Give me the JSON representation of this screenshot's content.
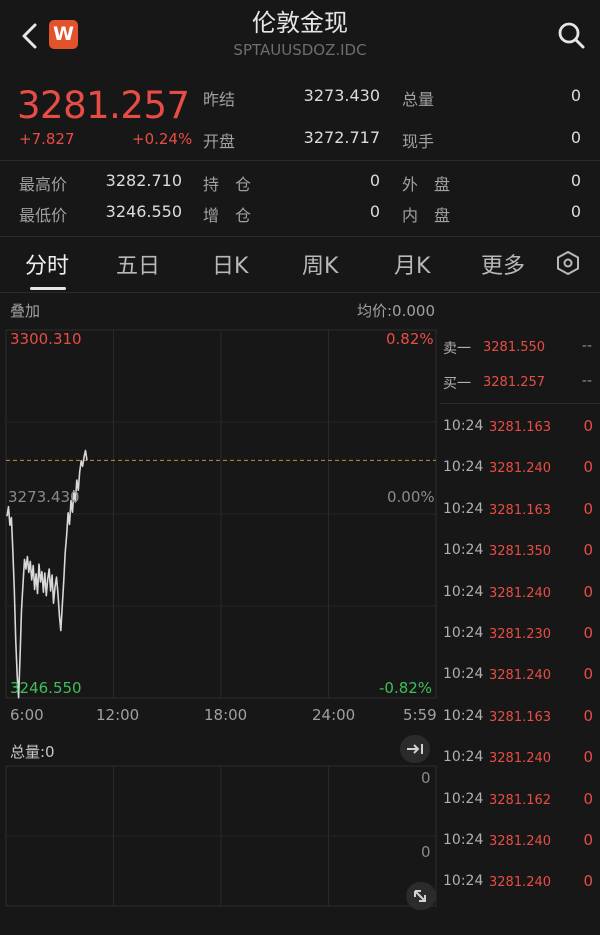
{
  "header": {
    "title": "伦敦金现",
    "code": "SPTAUUSDOZ.IDC",
    "badge": "W"
  },
  "quote": {
    "price": "3281.257",
    "change": "+7.827",
    "change_pct": "+0.24%",
    "stats": [
      {
        "label": "昨结",
        "value": "3273.430"
      },
      {
        "label": "总量",
        "value": "0"
      },
      {
        "label": "开盘",
        "value": "3272.717"
      },
      {
        "label": "现手",
        "value": "0"
      },
      {
        "label": "最高价",
        "value": "3282.710"
      },
      {
        "label": "持　仓",
        "value": "0"
      },
      {
        "label": "外　盘",
        "value": "0"
      },
      {
        "label": "最低价",
        "value": "3246.550"
      },
      {
        "label": "增　仓",
        "value": "0"
      },
      {
        "label": "内　盘",
        "value": "0"
      }
    ]
  },
  "tabs": [
    "分时",
    "五日",
    "日K",
    "周K",
    "月K",
    "更多"
  ],
  "active_tab": "分时",
  "chart": {
    "overlay_label": "叠加",
    "avg_label": "均价:0.000",
    "price_high": "3300.310",
    "price_mid": "3273.430",
    "price_low": "3246.550",
    "pct_high": "0.82%",
    "pct_mid": "0.00%",
    "pct_low": "-0.82%",
    "time_labels": [
      "6:00",
      "12:00",
      "18:00",
      "24:00",
      "5:59"
    ],
    "volume_label": "总量:0",
    "volume_top": "0",
    "volume_mid": "0",
    "colors": {
      "up": "#e84d45",
      "down": "#3fbf5a",
      "line": "#d8d8d8",
      "ref": "#c98a3a"
    }
  },
  "chart_data": {
    "type": "line",
    "x_labels": [
      "6:00",
      "12:00",
      "18:00",
      "24:00",
      "5:59"
    ],
    "ylim": [
      3246.55,
      3300.31
    ],
    "reference": 3273.43,
    "last": 3281.257,
    "series": [
      {
        "values": [
          3273.1,
          3274.5,
          3271.8,
          3272.9,
          3268.2,
          3262.4,
          3255.1,
          3249.8,
          3246.6,
          3252.8,
          3259.4,
          3263.2,
          3266.8,
          3265.4,
          3267.2,
          3264.9,
          3266.5,
          3263.8,
          3265.9,
          3262.4,
          3264.7,
          3261.8,
          3266.1,
          3263.5,
          3265.0,
          3262.0,
          3264.8,
          3261.5,
          3263.9,
          3265.4,
          3262.2,
          3264.5,
          3260.4,
          3262.8,
          3264.2,
          3261.9,
          3258.6,
          3256.4,
          3260.1,
          3263.5,
          3267.8,
          3270.2,
          3273.6,
          3271.9,
          3275.4,
          3273.7,
          3276.8,
          3275.2,
          3278.4,
          3276.9,
          3279.6,
          3281.2,
          3280.4,
          3281.8,
          3282.7,
          3281.257
        ]
      }
    ],
    "volume": {
      "values": [],
      "ylim": [
        0,
        0
      ]
    }
  },
  "order_book": [
    {
      "label": "卖一",
      "price": "3281.550",
      "qty": "--"
    },
    {
      "label": "买一",
      "price": "3281.257",
      "qty": "--"
    }
  ],
  "ticks": [
    {
      "time": "10:24",
      "price": "3281.163",
      "qty": "0"
    },
    {
      "time": "10:24",
      "price": "3281.240",
      "qty": "0"
    },
    {
      "time": "10:24",
      "price": "3281.163",
      "qty": "0"
    },
    {
      "time": "10:24",
      "price": "3281.350",
      "qty": "0"
    },
    {
      "time": "10:24",
      "price": "3281.240",
      "qty": "0"
    },
    {
      "time": "10:24",
      "price": "3281.230",
      "qty": "0"
    },
    {
      "time": "10:24",
      "price": "3281.240",
      "qty": "0"
    },
    {
      "time": "10:24",
      "price": "3281.163",
      "qty": "0"
    },
    {
      "time": "10:24",
      "price": "3281.240",
      "qty": "0"
    },
    {
      "time": "10:24",
      "price": "3281.162",
      "qty": "0"
    },
    {
      "time": "10:24",
      "price": "3281.240",
      "qty": "0"
    },
    {
      "time": "10:24",
      "price": "3281.240",
      "qty": "0"
    }
  ]
}
